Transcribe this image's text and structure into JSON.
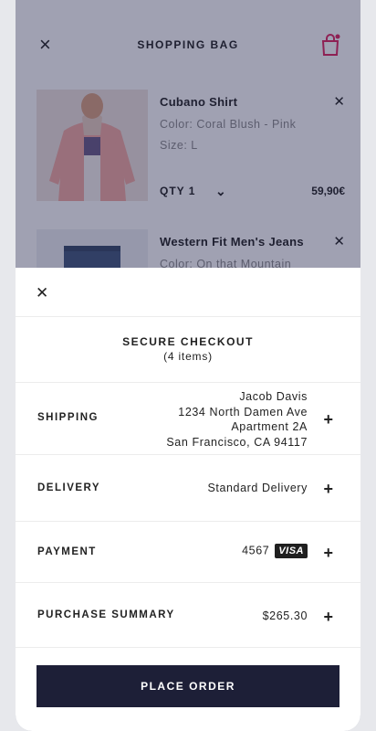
{
  "bag": {
    "title": "SHOPPING BAG",
    "close_icon": "close-icon",
    "bag_icon": "shopping-bag-icon",
    "badge_color": "#e0245e",
    "items": [
      {
        "name": "Cubano Shirt",
        "color": "Color: Coral Blush - Pink",
        "size": "Size: L",
        "qty": "QTY 1",
        "price": "59,90€"
      },
      {
        "name": "Western Fit Men's Jeans",
        "color": "Color: On that Mountain"
      }
    ]
  },
  "checkout": {
    "title": "SECURE CHECKOUT",
    "subtitle": "(4 items)",
    "shipping": {
      "label": "SHIPPING",
      "address": [
        "Jacob Davis",
        "1234 North Damen Ave",
        "Apartment 2A",
        "San Francisco, CA 94117"
      ]
    },
    "delivery": {
      "label": "DELIVERY",
      "value": "Standard Delivery"
    },
    "payment": {
      "label": "PAYMENT",
      "card_last4": "4567",
      "card_brand": "VISA"
    },
    "summary": {
      "label": "PURCHASE SUMMARY",
      "value": "$265.30"
    },
    "place_order_label": "PLACE ORDER",
    "accent_color": "#1d1f37"
  }
}
